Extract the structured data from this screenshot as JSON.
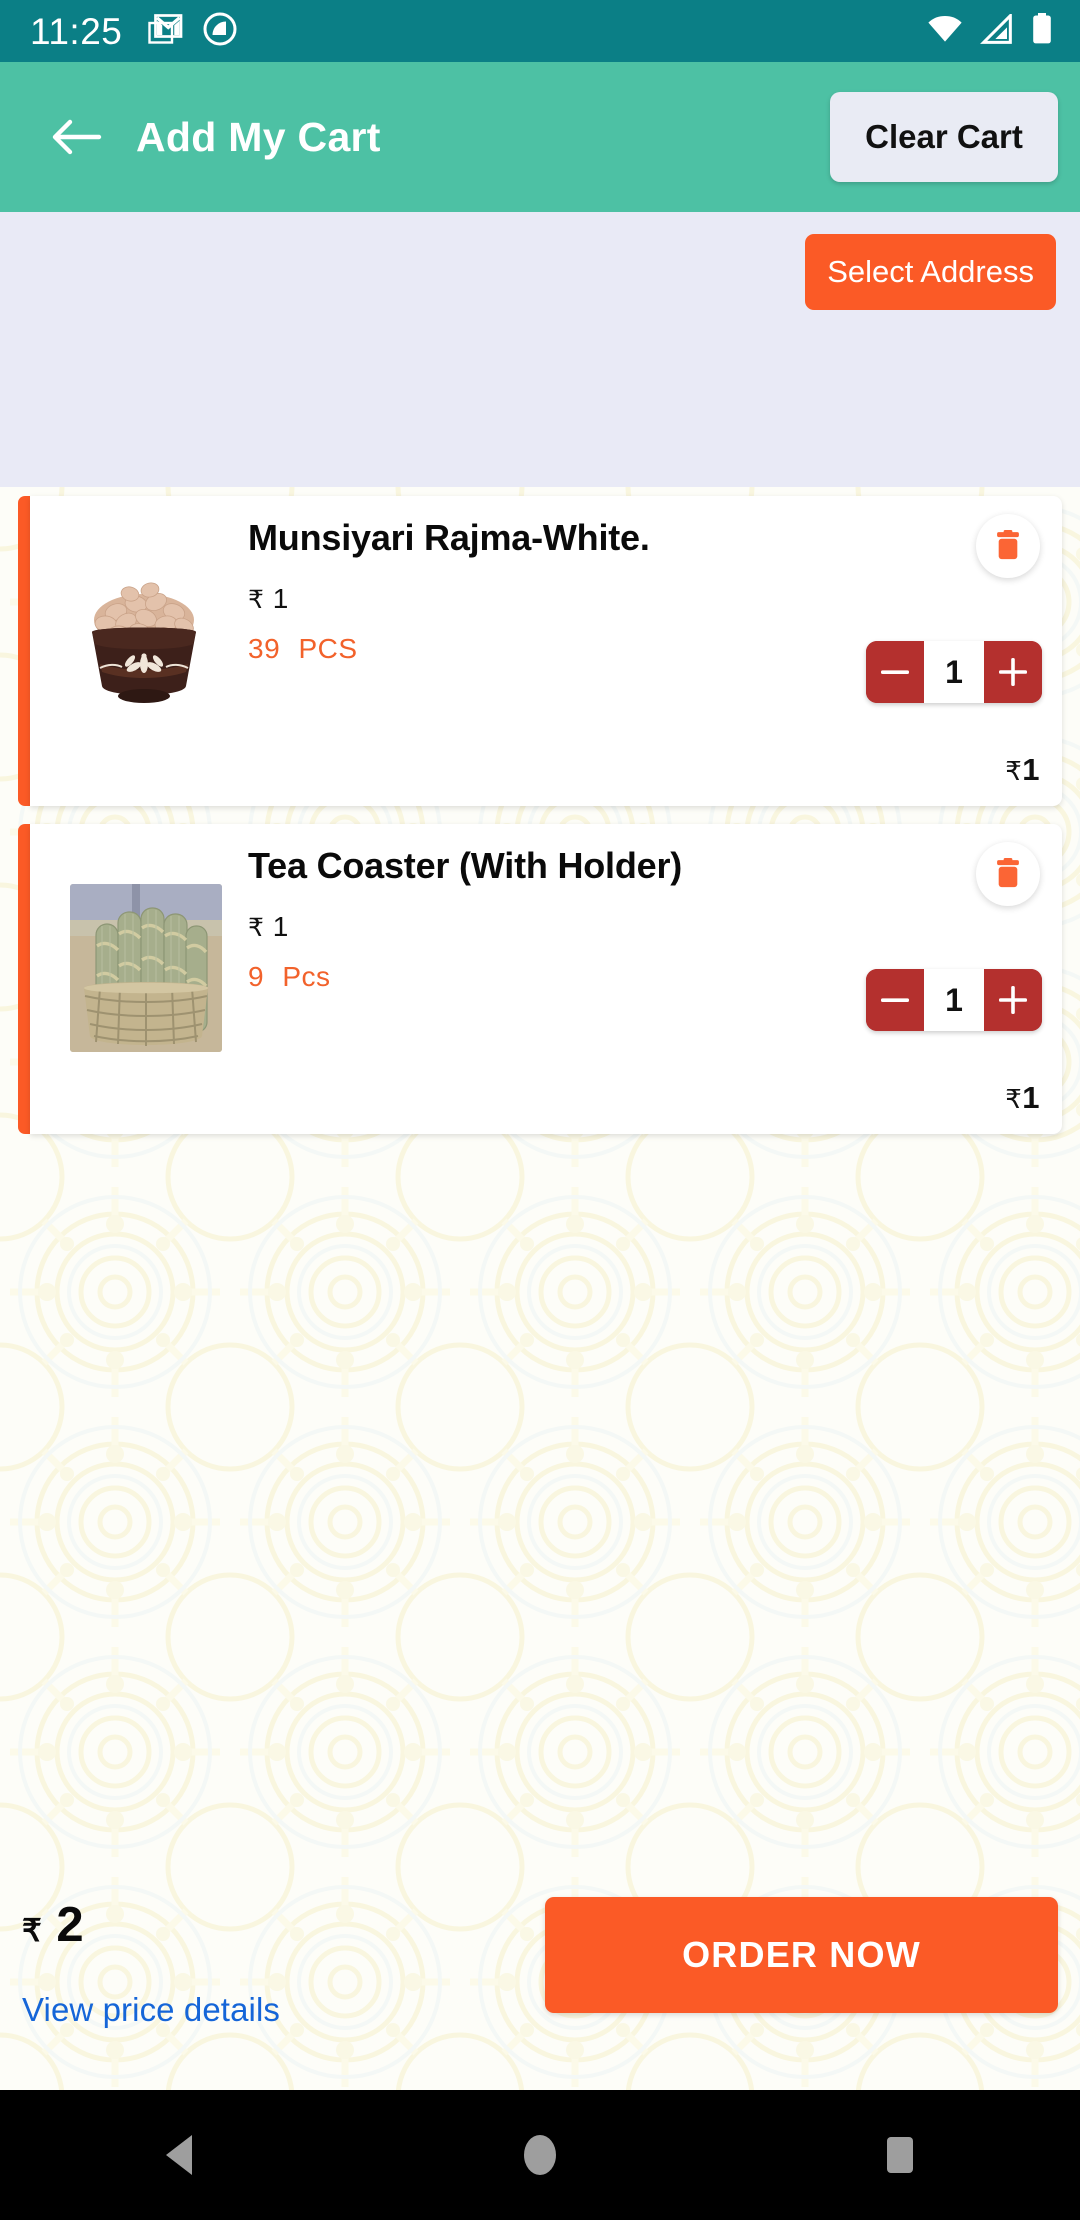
{
  "status_bar": {
    "time": "11:25",
    "left_icons": [
      "gmail-icon",
      "app-circle-icon"
    ],
    "right_icons": [
      "wifi-icon",
      "cellular-signal-icon",
      "battery-icon"
    ],
    "background_color": "#0B7F86"
  },
  "app_bar": {
    "back_icon": "back-arrow-icon",
    "title": "Add My Cart",
    "clear_cart_label": "Clear Cart",
    "background_color": "#4DC1A4"
  },
  "address_bar": {
    "select_address_label": "Select Address",
    "button_color": "#FB5A26",
    "background_color": "#E9EAF6"
  },
  "cart": {
    "items": [
      {
        "name": "Munsiyari Rajma-White.",
        "price": "1",
        "currency": "₹",
        "pack_qty": "39",
        "pack_unit": "PCS",
        "quantity": "1",
        "line_total": "1",
        "delete_icon": "trash-icon",
        "decrease_icon": "minus-icon",
        "increase_icon": "plus-icon",
        "image_alt": "bowl-of-white-rajma-beans"
      },
      {
        "name": "Tea Coaster (With Holder)",
        "price": "1",
        "currency": "₹",
        "pack_qty": "9",
        "pack_unit": "Pcs",
        "quantity": "1",
        "line_total": "1",
        "delete_icon": "trash-icon",
        "decrease_icon": "minus-icon",
        "increase_icon": "plus-icon",
        "image_alt": "woven-grass-tea-coasters-in-basket"
      }
    ]
  },
  "bottom_bar": {
    "total_currency": "₹",
    "total_amount": "2",
    "price_details_label": "View price details",
    "order_label": "ORDER NOW",
    "order_button_color": "#FB5A26",
    "link_color": "#1565D8"
  },
  "nav_bar": {
    "back_icon": "nav-back-triangle-icon",
    "home_icon": "nav-home-circle-icon",
    "recents_icon": "nav-recents-square-icon"
  }
}
